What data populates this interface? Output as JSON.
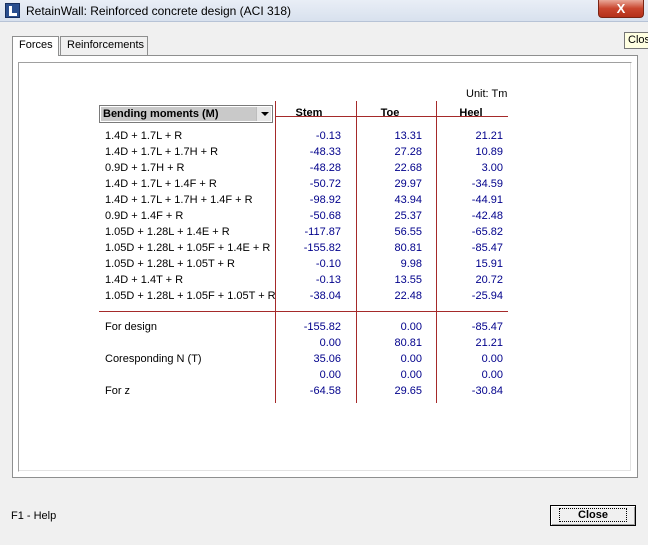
{
  "window": {
    "title": "RetainWall: Reinforced concrete design (ACI 318)",
    "close_glyph": "X",
    "tooltip": "Close"
  },
  "tabs": [
    {
      "label": "Forces",
      "active": true
    },
    {
      "label": "Reinforcements",
      "active": false
    }
  ],
  "unit_label": "Unit: Tm",
  "dropdown": {
    "selected": "Bending moments (M)"
  },
  "columns": [
    "Stem",
    "Toe",
    "Heel"
  ],
  "rows": [
    {
      "label": "1.4D + 1.7L + R",
      "values": [
        "-0.13",
        "13.31",
        "21.21"
      ]
    },
    {
      "label": "1.4D + 1.7L + 1.7H + R",
      "values": [
        "-48.33",
        "27.28",
        "10.89"
      ]
    },
    {
      "label": "0.9D + 1.7H + R",
      "values": [
        "-48.28",
        "22.68",
        "3.00"
      ]
    },
    {
      "label": "1.4D + 1.7L + 1.4F + R",
      "values": [
        "-50.72",
        "29.97",
        "-34.59"
      ]
    },
    {
      "label": "1.4D + 1.7L + 1.7H + 1.4F + R",
      "values": [
        "-98.92",
        "43.94",
        "-44.91"
      ]
    },
    {
      "label": "0.9D + 1.4F + R",
      "values": [
        "-50.68",
        "25.37",
        "-42.48"
      ]
    },
    {
      "label": "1.05D + 1.28L + 1.4E + R",
      "values": [
        "-117.87",
        "56.55",
        "-65.82"
      ]
    },
    {
      "label": "1.05D + 1.28L + 1.05F + 1.4E + R",
      "values": [
        "-155.82",
        "80.81",
        "-85.47"
      ]
    },
    {
      "label": "1.05D + 1.28L + 1.05T + R",
      "values": [
        "-0.10",
        "9.98",
        "15.91"
      ]
    },
    {
      "label": "1.4D + 1.4T + R",
      "values": [
        "-0.13",
        "13.55",
        "20.72"
      ]
    },
    {
      "label": "1.05D + 1.28L + 1.05F + 1.05T + R",
      "values": [
        "-38.04",
        "22.48",
        "-25.94"
      ]
    }
  ],
  "summary": [
    {
      "label": "For design",
      "values": [
        "-155.82",
        "0.00",
        "-85.47"
      ]
    },
    {
      "label": "",
      "values": [
        "0.00",
        "80.81",
        "21.21"
      ]
    },
    {
      "label": "Coresponding N (T)",
      "values": [
        "35.06",
        "0.00",
        "0.00"
      ]
    },
    {
      "label": "",
      "values": [
        "0.00",
        "0.00",
        "0.00"
      ]
    },
    {
      "label": "For z",
      "values": [
        "-64.58",
        "29.65",
        "-30.84"
      ]
    }
  ],
  "footer": {
    "help": "F1 - Help",
    "close_button": "Close"
  }
}
